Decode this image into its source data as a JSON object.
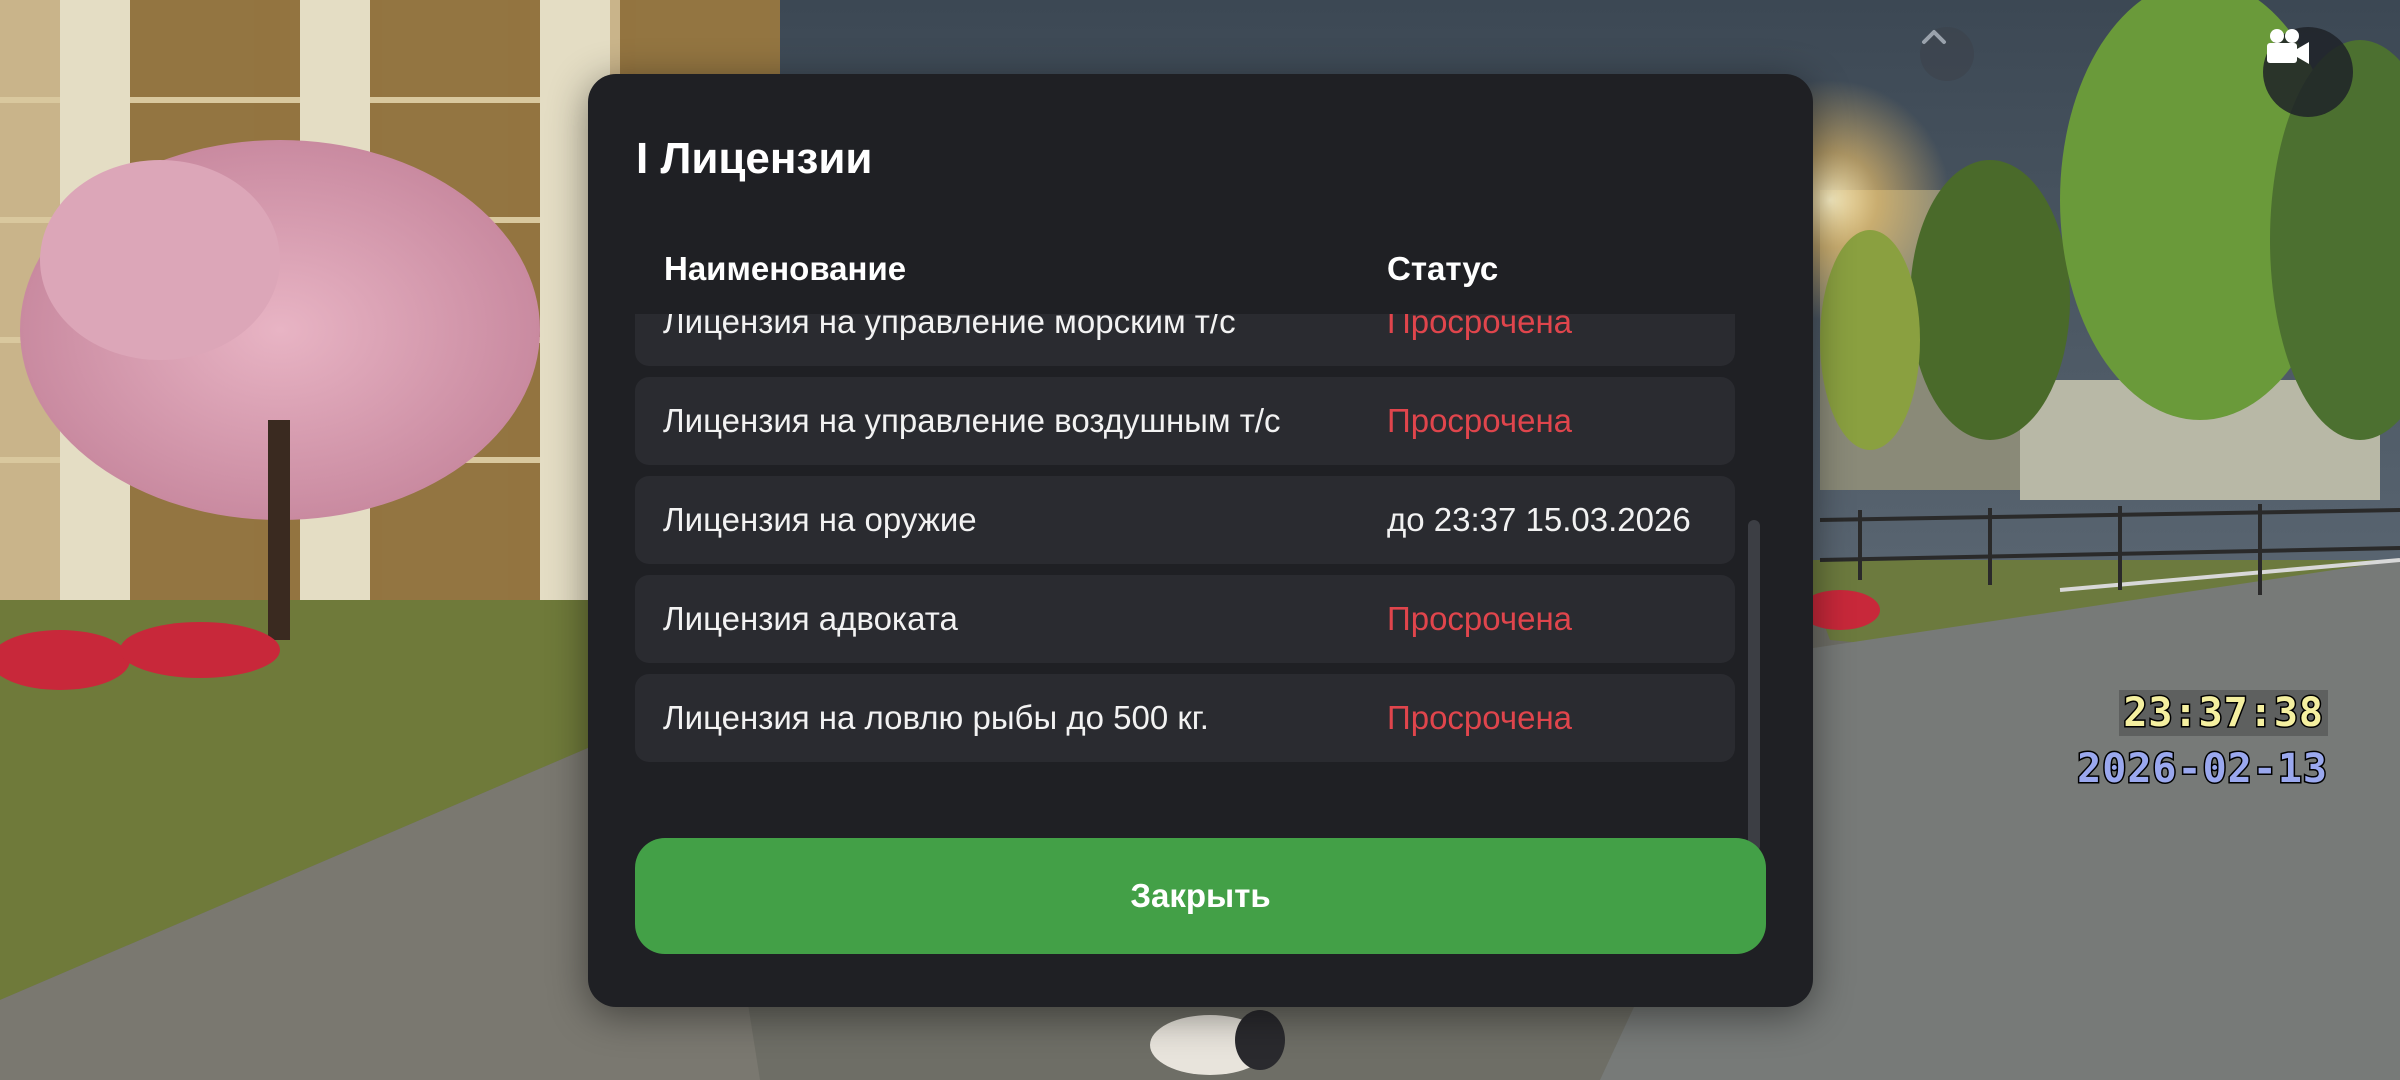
{
  "modal": {
    "title": "I Лицензии",
    "columns": {
      "name": "Наименование",
      "status": "Статус"
    },
    "rows": [
      {
        "name": "Лицензия на управление морским т/с",
        "status": "Просрочена",
        "expired": true
      },
      {
        "name": "Лицензия на управление воздушным т/с",
        "status": "Просрочена",
        "expired": true
      },
      {
        "name": "Лицензия на оружие",
        "status": "до 23:37 15.03.2026",
        "expired": false
      },
      {
        "name": "Лицензия адвоката",
        "status": "Просрочена",
        "expired": true
      },
      {
        "name": "Лицензия на ловлю рыбы до 500 кг.",
        "status": "Просрочена",
        "expired": true
      }
    ],
    "close_label": "Закрыть"
  },
  "hud": {
    "time": "23:37:38",
    "date": "2026-02-13",
    "camera_icon": "video-camera-icon",
    "collapse_icon": "chevron-up-icon"
  },
  "colors": {
    "modal_bg": "#1f2024",
    "row_bg": "#2a2b30",
    "expired": "#e0454c",
    "button": "#43a047",
    "hud_time": "#f5f0a0",
    "hud_date": "#9aa8ee"
  }
}
